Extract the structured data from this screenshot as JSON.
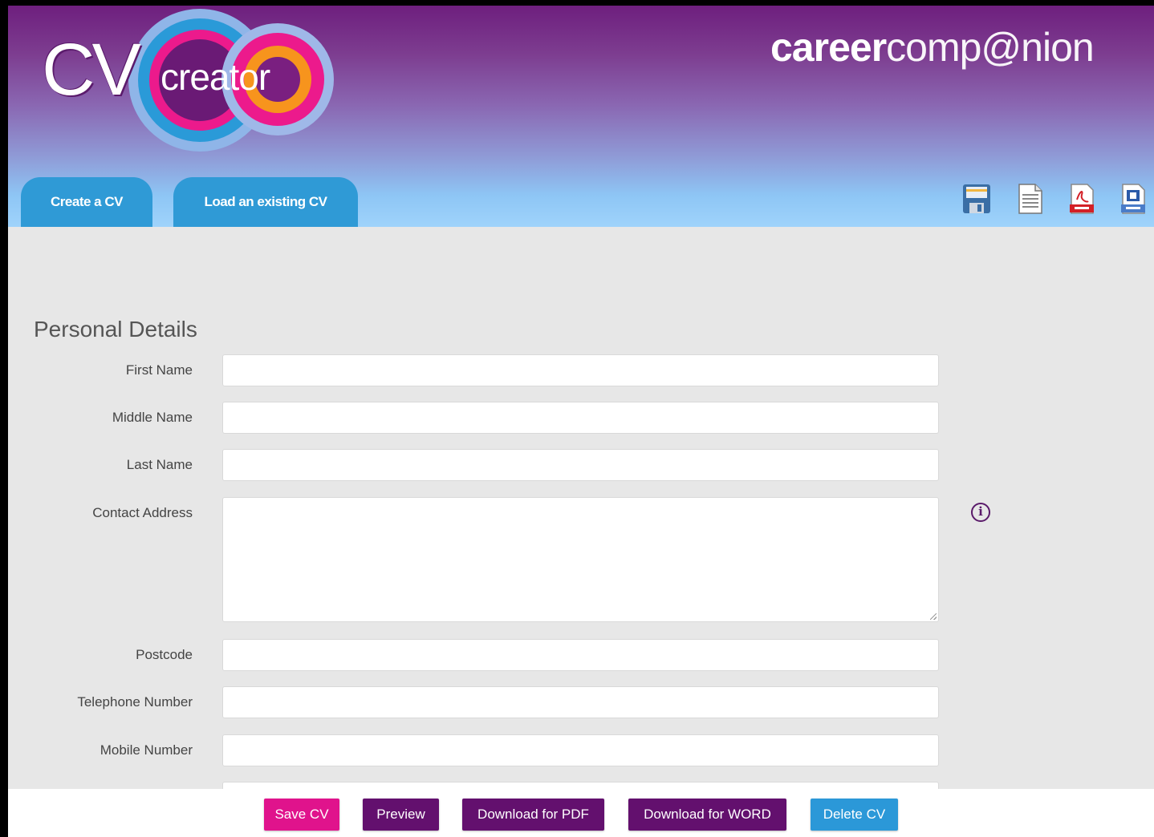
{
  "header": {
    "logo_cv": "CV",
    "logo_creator": "creator",
    "brand_career": "career",
    "brand_companion": "comp@nion"
  },
  "tabs": [
    {
      "label": "Create a CV"
    },
    {
      "label": "Load an existing CV"
    }
  ],
  "toolbar": {
    "icons": [
      "save-icon",
      "document-icon",
      "pdf-icon",
      "word-doc-icon"
    ]
  },
  "form": {
    "section_title": "Personal Details",
    "fields": [
      {
        "label": "First Name",
        "value": ""
      },
      {
        "label": "Middle Name",
        "value": ""
      },
      {
        "label": "Last Name",
        "value": ""
      },
      {
        "label": "Contact Address",
        "value": ""
      },
      {
        "label": "Postcode",
        "value": ""
      },
      {
        "label": "Telephone Number",
        "value": ""
      },
      {
        "label": "Mobile Number",
        "value": ""
      }
    ]
  },
  "footer": {
    "buttons": [
      {
        "label": "Save CV"
      },
      {
        "label": "Preview"
      },
      {
        "label": "Download for PDF"
      },
      {
        "label": "Download for WORD"
      },
      {
        "label": "Delete CV"
      }
    ]
  },
  "colors": {
    "header_top": "#6e1f7e",
    "header_bottom": "#9fd3fb",
    "tab_blue": "#2f9ad6",
    "button_purple": "#63106e",
    "button_pink": "#e0138c",
    "button_blue": "#2b98d8"
  }
}
